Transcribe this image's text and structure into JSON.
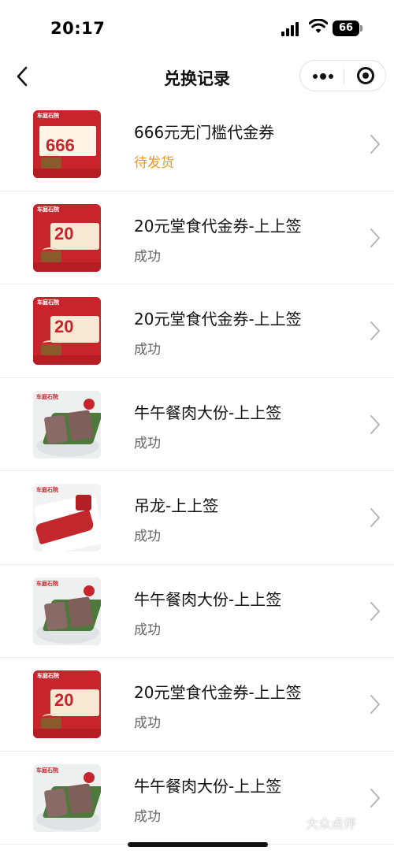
{
  "status_bar": {
    "time": "20:17",
    "battery": "66"
  },
  "nav": {
    "title": "兑换记录",
    "back_icon": "chevron-left-icon",
    "more_icon": "more-dots-icon",
    "close_icon": "target-circle-icon"
  },
  "records": [
    {
      "name": "666元无门槛代金券",
      "status": "待发货",
      "status_type": "pending",
      "thumb": "voucher-666",
      "thumb_value": "666",
      "thumb_brand": "车庭石院"
    },
    {
      "name": "20元堂食代金券-上上签",
      "status": "成功",
      "status_type": "success",
      "thumb": "voucher-20",
      "thumb_value": "20",
      "thumb_brand": "车庭石院"
    },
    {
      "name": "20元堂食代金券-上上签",
      "status": "成功",
      "status_type": "success",
      "thumb": "voucher-20",
      "thumb_value": "20",
      "thumb_brand": "车庭石院"
    },
    {
      "name": "牛午餐肉大份-上上签",
      "status": "成功",
      "status_type": "success",
      "thumb": "luncheon-meat",
      "thumb_brand": "车庭石院"
    },
    {
      "name": "吊龙-上上签",
      "status": "成功",
      "status_type": "success",
      "thumb": "beef-slice",
      "thumb_brand": "车庭石院"
    },
    {
      "name": "牛午餐肉大份-上上签",
      "status": "成功",
      "status_type": "success",
      "thumb": "luncheon-meat",
      "thumb_brand": "车庭石院"
    },
    {
      "name": "20元堂食代金券-上上签",
      "status": "成功",
      "status_type": "success",
      "thumb": "voucher-20",
      "thumb_value": "20",
      "thumb_brand": "车庭石院"
    },
    {
      "name": "牛午餐肉大份-上上签",
      "status": "成功",
      "status_type": "success",
      "thumb": "luncheon-meat",
      "thumb_brand": "车庭石院"
    }
  ],
  "watermark": "大众点评",
  "colors": {
    "pending": "#e49a1f",
    "success": "#666666",
    "brand_red": "#c8242b"
  }
}
